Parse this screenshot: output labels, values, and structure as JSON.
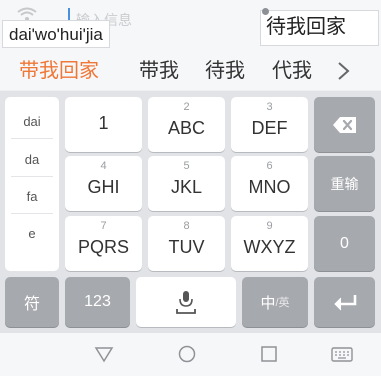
{
  "input": {
    "hint": "输入信息",
    "preedit": "dai'wo'hui'jia",
    "preview": "待我回家"
  },
  "candidates": [
    "带我回家",
    "带我",
    "待我",
    "代我"
  ],
  "syllables": [
    "dai",
    "da",
    "fa",
    "e"
  ],
  "keys": {
    "row1": [
      {
        "num": "",
        "label": "1"
      },
      {
        "num": "2",
        "label": "ABC"
      },
      {
        "num": "3",
        "label": "DEF"
      }
    ],
    "row2": [
      {
        "num": "4",
        "label": "GHI"
      },
      {
        "num": "5",
        "label": "JKL"
      },
      {
        "num": "6",
        "label": "MNO"
      }
    ],
    "row3": [
      {
        "num": "7",
        "label": "PQRS"
      },
      {
        "num": "8",
        "label": "TUV"
      },
      {
        "num": "9",
        "label": "WXYZ"
      }
    ],
    "retype": "重输",
    "zero": "0",
    "symbol": "符",
    "num": "123",
    "lang_main": "中",
    "lang_sub": "/英"
  },
  "icons": {
    "wifi": "wifi-icon",
    "more": "chevron-right-icon",
    "backspace": "backspace-icon",
    "mic": "microphone-icon",
    "enter": "enter-icon",
    "back": "triangle-back-icon",
    "home": "circle-home-icon",
    "recent": "square-recent-icon",
    "keyboard": "keyboard-icon"
  },
  "colors": {
    "accent": "#f07837",
    "dark_key": "#a6a9ae",
    "keyboard_bg": "#e1e3e6"
  }
}
